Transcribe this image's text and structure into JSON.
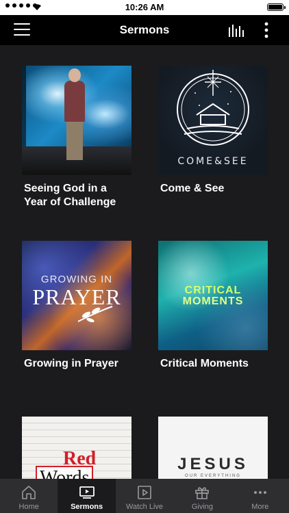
{
  "status_bar": {
    "time": "10:26 AM"
  },
  "nav": {
    "title": "Sermons"
  },
  "sermons": [
    {
      "title": "Seeing God in a Year of Challenge"
    },
    {
      "title": "Come & See",
      "art_text": "COME&SEE"
    },
    {
      "title": "Growing in Prayer",
      "art_small": "GROWING IN",
      "art_big": "PRAYER"
    },
    {
      "title": "Critical Moments",
      "art_line1": "CRITICAL",
      "art_line2": "MOMENTS"
    },
    {
      "title": "",
      "art_red": "Red",
      "art_words": "Words"
    },
    {
      "title": "",
      "art_main": "JESUS",
      "art_sub": "OUR EVERYTHING"
    }
  ],
  "tabs": [
    {
      "label": "Home",
      "icon": "home-icon"
    },
    {
      "label": "Sermons",
      "icon": "video-icon",
      "active": true
    },
    {
      "label": "Watch Live",
      "icon": "play-icon"
    },
    {
      "label": "Giving",
      "icon": "gift-icon"
    },
    {
      "label": "More",
      "icon": "more-icon"
    }
  ],
  "colors": {
    "background": "#1b1b1d",
    "nav_bar": "#000000",
    "tab_bar": "#2e2e30",
    "active_tab": "#1b1b1d"
  }
}
